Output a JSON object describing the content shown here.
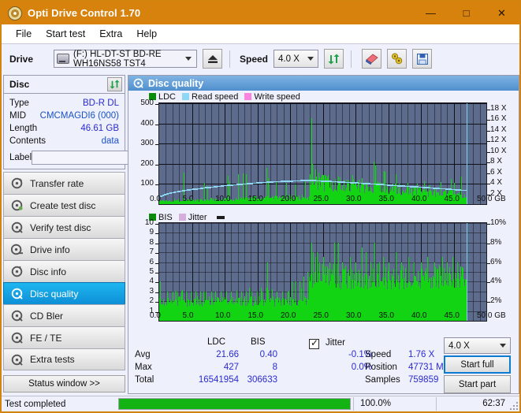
{
  "window": {
    "title": "Opti Drive Control 1.70",
    "icon": "disc-icon",
    "minimize": "—",
    "maximize": "□",
    "close": "✕"
  },
  "menu": {
    "items": [
      "File",
      "Start test",
      "Extra",
      "Help"
    ]
  },
  "toolbar": {
    "drive_label": "Drive",
    "drive_value": "(F:)  HL-DT-ST BD-RE  WH16NS58 TST4",
    "eject_icon": "eject-icon",
    "speed_label": "Speed",
    "speed_value": "4.0 X",
    "refresh_icon": "refresh-icon",
    "erase_icon": "eraser-icon",
    "tools_icon": "tools-icon",
    "save_icon": "save-icon"
  },
  "disc": {
    "header": "Disc",
    "refresh_icon": "refresh-icon",
    "rows": [
      {
        "key": "Type",
        "value": "BD-R DL"
      },
      {
        "key": "MID",
        "value": "CMCMAGDI6 (000)"
      },
      {
        "key": "Length",
        "value": "46.61 GB"
      },
      {
        "key": "Contents",
        "value": "data"
      }
    ],
    "label_key": "Label",
    "label_value": "",
    "label_placeholder": "",
    "label_button_icon": "disc-icon"
  },
  "nav": {
    "items": [
      {
        "label": "Transfer rate",
        "icon": "disc-transfer-icon",
        "active": false
      },
      {
        "label": "Create test disc",
        "icon": "disc-create-icon",
        "active": false
      },
      {
        "label": "Verify test disc",
        "icon": "disc-verify-icon",
        "active": false
      },
      {
        "label": "Drive info",
        "icon": "disc-drive-icon",
        "active": false
      },
      {
        "label": "Disc info",
        "icon": "disc-info-icon",
        "active": false
      },
      {
        "label": "Disc quality",
        "icon": "disc-quality-icon",
        "active": true
      },
      {
        "label": "CD Bler",
        "icon": "disc-bler-icon",
        "active": false
      },
      {
        "label": "FE / TE",
        "icon": "disc-fete-icon",
        "active": false
      },
      {
        "label": "Extra tests",
        "icon": "disc-extra-icon",
        "active": false
      }
    ],
    "status_window": "Status window >>"
  },
  "panel": {
    "title": "Disc quality",
    "title_icon": "disc-quality-icon"
  },
  "chart_data": [
    {
      "type": "area",
      "name": "ldc-chart",
      "title": "",
      "xlabel": "GB",
      "ylabel": "",
      "xlim": [
        0,
        50
      ],
      "ylim": [
        0,
        500
      ],
      "xticks": [
        "0.0",
        "5.0",
        "10.0",
        "15.0",
        "20.0",
        "25.0",
        "30.0",
        "35.0",
        "40.0",
        "45.0",
        "50.0"
      ],
      "yticks": [
        "100",
        "200",
        "300",
        "400",
        "500"
      ],
      "y2ticks": [
        "2 X",
        "4 X",
        "6 X",
        "8 X",
        "10 X",
        "12 X",
        "14 X",
        "16 X",
        "18 X"
      ],
      "y2lim": [
        0,
        19
      ],
      "grid": true,
      "legend_position": "top",
      "legend": [
        {
          "label": "LDC",
          "color": "#12b312"
        },
        {
          "label": "Read speed",
          "color": "#8fd8f5"
        },
        {
          "label": "Write speed",
          "color": "#f884e0"
        }
      ],
      "data_end_gb": 47.0,
      "series": [
        {
          "name": "LDC",
          "color": "#12d412",
          "note": "scan error bars, baseline ~20-40, spikes up to 427",
          "baseline": [
            18,
            22,
            20,
            25,
            22,
            19,
            24,
            21,
            26,
            23,
            20,
            24,
            22,
            28,
            25,
            21,
            26,
            23,
            20,
            25,
            28,
            24,
            21,
            27,
            24,
            22,
            26,
            23,
            29,
            25,
            22,
            27,
            24,
            21,
            26,
            30,
            25,
            22,
            28,
            25,
            23,
            27,
            24,
            30,
            26,
            23,
            28,
            25,
            22,
            27,
            24,
            29,
            26,
            23,
            28,
            25,
            31,
            27,
            24,
            29,
            26,
            23,
            28,
            31,
            26,
            24,
            29,
            26,
            33,
            28,
            25,
            30,
            27,
            24,
            29,
            26,
            32,
            28,
            25,
            30,
            27,
            34,
            29,
            26,
            31,
            28,
            25,
            30,
            27,
            33,
            29,
            26,
            31,
            28,
            35,
            30,
            27,
            32,
            29,
            26,
            31,
            28,
            34,
            30,
            27,
            32,
            29,
            36,
            31,
            28,
            33,
            30,
            27,
            32,
            29,
            35,
            31,
            28,
            33,
            30,
            38,
            32,
            29,
            34,
            31,
            28,
            33,
            30,
            36,
            32,
            29,
            34,
            31,
            39,
            33,
            30,
            35,
            32,
            29,
            34,
            31,
            37,
            33,
            30,
            35,
            32,
            40,
            34,
            31,
            36,
            33,
            30,
            35,
            32,
            38,
            34,
            31,
            36,
            33,
            41,
            35,
            32,
            37,
            34,
            31,
            36,
            33,
            39,
            35,
            32,
            37,
            34,
            42,
            36,
            33,
            38,
            35,
            32,
            37,
            34,
            40,
            36,
            33,
            38,
            35,
            60,
            75,
            90,
            105,
            118,
            112,
            108,
            115,
            110,
            105,
            112,
            108,
            103,
            110,
            106,
            101,
            108,
            104,
            99,
            106,
            102,
            97,
            104,
            100,
            95,
            102,
            98,
            93,
            100,
            96,
            91,
            98,
            94,
            89,
            96,
            92,
            87,
            94,
            90,
            85,
            92,
            88,
            83,
            90,
            86,
            81,
            88,
            84,
            79,
            86,
            82,
            77,
            84,
            80,
            75,
            82,
            78,
            73,
            80,
            76,
            71,
            78,
            74,
            69,
            76,
            72,
            67,
            74,
            70,
            65,
            72,
            68,
            63,
            70,
            66,
            61,
            68,
            64,
            59,
            66,
            62,
            57,
            64,
            60,
            55,
            62,
            58,
            53,
            60,
            56,
            51,
            58,
            54,
            49,
            56,
            52,
            47,
            54,
            50,
            45,
            52,
            48,
            43,
            50,
            46,
            41,
            48,
            44,
            39,
            46,
            42,
            37,
            44,
            40,
            35,
            42,
            38,
            33,
            40,
            36,
            31,
            38,
            34,
            29,
            36,
            32,
            27,
            34,
            30,
            25,
            32,
            28,
            23,
            30,
            26,
            21,
            28,
            24,
            19,
            26,
            22,
            17,
            24,
            20
          ],
          "spikes": [
            [
              3.7,
              155
            ],
            [
              6.9,
              105
            ],
            [
              7.3,
              90
            ],
            [
              10.5,
              140
            ],
            [
              10.7,
              115
            ],
            [
              12.0,
              150
            ],
            [
              12.8,
              152
            ],
            [
              13.3,
              150
            ],
            [
              16.4,
              180
            ],
            [
              16.6,
              128
            ],
            [
              17.8,
              110
            ],
            [
              19.4,
              105
            ],
            [
              20.9,
              98
            ],
            [
              22.3,
              120
            ],
            [
              23.2,
              425
            ],
            [
              23.4,
              200
            ],
            [
              23.9,
              170
            ],
            [
              24.3,
              155
            ],
            [
              25.8,
              145
            ],
            [
              26.4,
              110
            ],
            [
              27.3,
              135
            ],
            [
              28.2,
              120
            ],
            [
              29.5,
              145
            ],
            [
              31.0,
              130
            ],
            [
              32.8,
              210
            ],
            [
              33.0,
              190
            ],
            [
              34.5,
              140
            ],
            [
              36.2,
              150
            ],
            [
              38.0,
              105
            ],
            [
              39.4,
              100
            ],
            [
              40.5,
              115
            ],
            [
              41.3,
              95
            ],
            [
              43.0,
              110
            ],
            [
              44.6,
              125
            ],
            [
              45.1,
              105
            ],
            [
              46.2,
              135
            ]
          ]
        },
        {
          "name": "Read speed",
          "color": "#aee4f8",
          "note": "rises from ~1.6X to ~4.6X then tapers down",
          "points_x": [
            0,
            1,
            2,
            3,
            4,
            5,
            6,
            7,
            8,
            9,
            10,
            11,
            12,
            13,
            14,
            15,
            16,
            17,
            18,
            19,
            20,
            21,
            22,
            23,
            23.5,
            24,
            26,
            28,
            30,
            32,
            34,
            36,
            38,
            40,
            42,
            44,
            46,
            47
          ],
          "points_y": [
            1.5,
            2.0,
            2.3,
            2.5,
            2.7,
            2.9,
            3.0,
            3.2,
            3.3,
            3.45,
            3.6,
            3.7,
            3.8,
            3.9,
            4.0,
            4.1,
            4.2,
            4.3,
            4.35,
            4.4,
            4.45,
            4.5,
            4.55,
            4.6,
            4.6,
            4.5,
            4.4,
            4.25,
            4.1,
            3.95,
            3.8,
            3.6,
            3.45,
            3.3,
            3.1,
            2.95,
            2.75,
            2.7
          ]
        }
      ]
    },
    {
      "type": "area",
      "name": "bis-chart",
      "title": "",
      "xlabel": "GB",
      "ylabel": "",
      "xlim": [
        0,
        50
      ],
      "ylim": [
        0,
        10
      ],
      "xticks": [
        "0.0",
        "5.0",
        "10.0",
        "15.0",
        "20.0",
        "25.0",
        "30.0",
        "35.0",
        "40.0",
        "45.0",
        "50.0"
      ],
      "yticks": [
        "1",
        "2",
        "3",
        "4",
        "5",
        "6",
        "7",
        "8",
        "9",
        "10"
      ],
      "y2ticks": [
        "2%",
        "4%",
        "6%",
        "8%",
        "10%"
      ],
      "y2lim": [
        0,
        10
      ],
      "grid": true,
      "legend_position": "top",
      "legend": [
        {
          "label": "BIS",
          "color": "#12b312"
        },
        {
          "label": "Jitter",
          "color": "#d6aede"
        }
      ],
      "data_end_gb": 47.0,
      "series": [
        {
          "name": "BIS",
          "color": "#12d412",
          "note": "baseline ~2 rising to ~4.5 after 23GB; occasional spikes to 6-8",
          "baseline_before_23": 2.0,
          "baseline_after_23": 4.4,
          "spikes": [
            [
              0.1,
              4.0
            ],
            [
              1.2,
              3.0
            ],
            [
              2.0,
              3.0
            ],
            [
              2.6,
              3.0
            ],
            [
              3.4,
              3.0
            ],
            [
              4.1,
              3.0
            ],
            [
              4.9,
              3.0
            ],
            [
              5.6,
              3.0
            ],
            [
              6.3,
              3.0
            ],
            [
              7.1,
              3.0
            ],
            [
              7.9,
              3.0
            ],
            [
              8.6,
              3.0
            ],
            [
              9.4,
              3.0
            ],
            [
              10.2,
              3.0
            ],
            [
              11.0,
              3.0
            ],
            [
              11.8,
              3.0
            ],
            [
              12.5,
              3.0
            ],
            [
              13.3,
              3.0
            ],
            [
              14.1,
              3.0
            ],
            [
              14.9,
              3.0
            ],
            [
              15.7,
              3.0
            ],
            [
              16.5,
              6.0
            ],
            [
              17.2,
              3.0
            ],
            [
              18.0,
              3.0
            ],
            [
              18.8,
              3.0
            ],
            [
              19.6,
              3.0
            ],
            [
              20.3,
              4.0
            ],
            [
              20.9,
              4.0
            ],
            [
              21.5,
              4.0
            ],
            [
              22.1,
              4.5
            ],
            [
              22.7,
              5.0
            ],
            [
              23.2,
              8.0
            ],
            [
              23.5,
              7.0
            ],
            [
              23.8,
              6.5
            ],
            [
              24.1,
              7.0
            ],
            [
              24.5,
              6.0
            ],
            [
              25.1,
              6.5
            ],
            [
              26.0,
              6.0
            ],
            [
              26.8,
              8.0
            ],
            [
              27.3,
              8.0
            ],
            [
              28.0,
              6.0
            ],
            [
              29.2,
              6.5
            ],
            [
              30.0,
              6.0
            ],
            [
              31.0,
              7.5
            ],
            [
              31.6,
              7.0
            ],
            [
              32.3,
              6.0
            ],
            [
              32.9,
              8.0
            ],
            [
              33.6,
              6.0
            ],
            [
              34.2,
              6.5
            ],
            [
              35.0,
              6.0
            ],
            [
              36.2,
              7.0
            ],
            [
              37.0,
              6.0
            ],
            [
              38.1,
              6.5
            ],
            [
              38.9,
              6.0
            ],
            [
              40.0,
              6.0
            ],
            [
              41.0,
              6.5
            ],
            [
              42.0,
              6.0
            ],
            [
              43.2,
              6.5
            ],
            [
              44.0,
              6.0
            ],
            [
              44.8,
              6.5
            ],
            [
              45.6,
              6.0
            ],
            [
              46.3,
              5.5
            ]
          ]
        },
        {
          "name": "Jitter",
          "color": "#d6aede",
          "note": "not plotted / flat",
          "values": []
        }
      ]
    }
  ],
  "stats": {
    "col_ldc": "LDC",
    "col_bis": "BIS",
    "rows": [
      {
        "label": "Avg",
        "ldc": "21.66",
        "bis": "0.40",
        "jitter": "-0.1%"
      },
      {
        "label": "Max",
        "ldc": "427",
        "bis": "8",
        "jitter": "0.0%"
      },
      {
        "label": "Total",
        "ldc": "16541954",
        "bis": "306633",
        "jitter": ""
      }
    ],
    "jitter_label": "Jitter",
    "jitter_checked": true,
    "speed_key": "Speed",
    "speed_val": "1.76 X",
    "position_key": "Position",
    "position_val": "47731 MB",
    "samples_key": "Samples",
    "samples_val": "759859",
    "speed_select": "4.0 X",
    "start_full": "Start full",
    "start_part": "Start part"
  },
  "statusbar": {
    "text": "Test completed",
    "progress_percent": 100.0,
    "progress_label": "100.0%",
    "elapsed": "62:37"
  },
  "colors": {
    "titlebar": "#d7820d",
    "accent_blue": "#4f8fce",
    "plot_bg": "#5d6c8c",
    "data_green": "#12d412",
    "value_blue": "#2b2bd0",
    "progress_green": "#12b312"
  }
}
